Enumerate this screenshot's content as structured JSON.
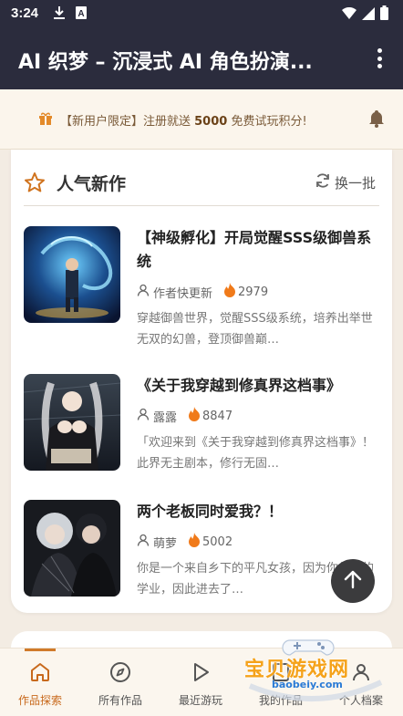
{
  "status_bar": {
    "time": "3:24"
  },
  "app_bar": {
    "title": "AI 织梦 – 沉浸式 AI 角色扮演..."
  },
  "promo": {
    "prefix": "【新用户限定】注册就送 ",
    "amount": "5000",
    "suffix": " 免费试玩积分!"
  },
  "section": {
    "title": "人气新作",
    "refresh_label": "换一批"
  },
  "items": [
    {
      "title": "【神级孵化】开局觉醒SSS级御兽系统",
      "author": "作者快更新",
      "heat": "2979",
      "desc": "穿越御兽世界，觉醒SSS级系统，培养出举世无双的幻兽，登顶御兽巅…"
    },
    {
      "title": "《关于我穿越到修真界这档事》",
      "author": "露露",
      "heat": "8847",
      "desc": "「欢迎来到《关于我穿越到修真界这档事》！ 此界无主剧本，修行无固…"
    },
    {
      "title": "两个老板同时爱我？！",
      "author": "萌萝",
      "heat": "5002",
      "desc": "你是一个来自乡下的平凡女孩，因为你优秀的学业，因此进去了…"
    }
  ],
  "nav": [
    {
      "label": "作品探索",
      "icon": "home-icon"
    },
    {
      "label": "所有作品",
      "icon": "compass-icon"
    },
    {
      "label": "最近游玩",
      "icon": "play-icon"
    },
    {
      "label": "我的作品",
      "icon": "works-icon"
    },
    {
      "label": "个人档案",
      "icon": "profile-icon"
    }
  ],
  "watermark": {
    "text": "宝贝游戏网",
    "url": "baobeiy.com"
  },
  "colors": {
    "app_bar": "#2b2c3d",
    "accent": "#c8691c",
    "fire": "#f07a1a",
    "page_bg": "#f3ece3"
  }
}
